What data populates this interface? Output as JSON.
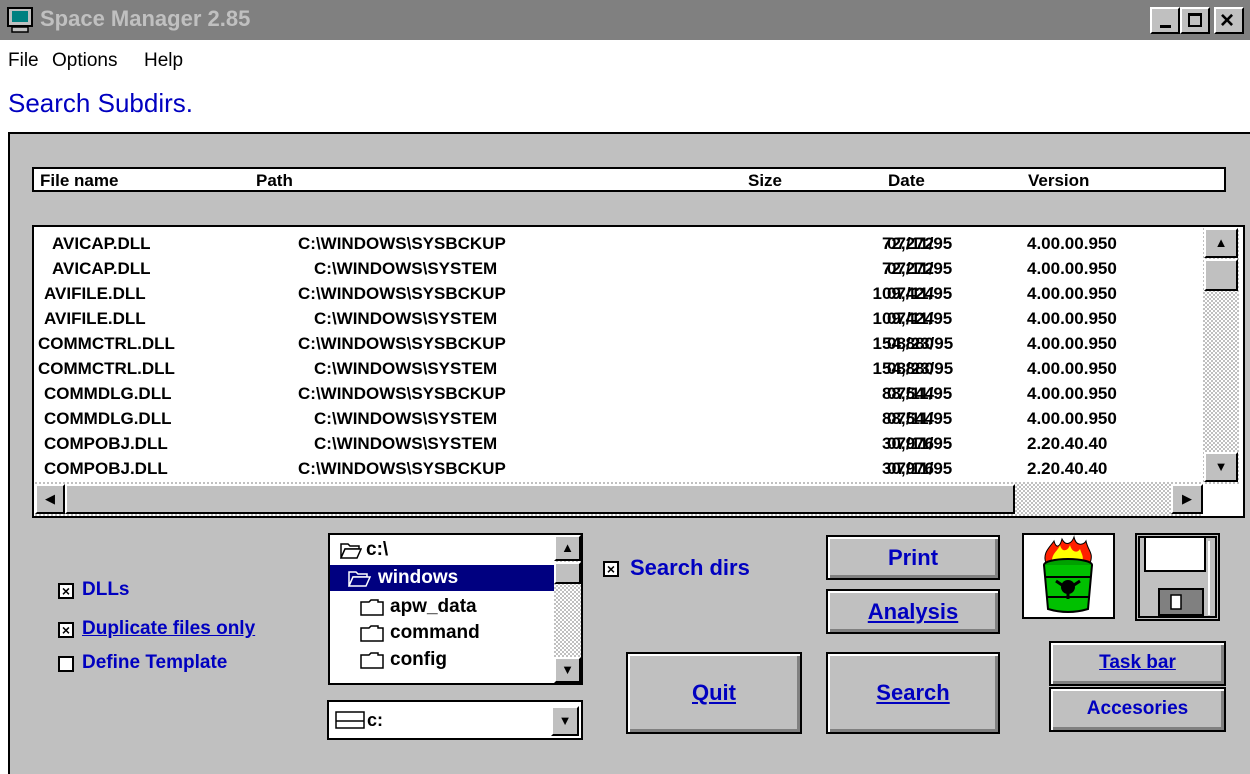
{
  "window": {
    "title": "Space Manager 2.85",
    "minimize_label": "_",
    "maximize_label": "□",
    "close_label": "×"
  },
  "menu": {
    "items": [
      {
        "label": "File"
      },
      {
        "label": "Options"
      },
      {
        "label": "Help"
      }
    ]
  },
  "status_text": "Search Subdirs.",
  "table": {
    "columns": [
      "File name",
      "Path",
      "Size",
      "Date",
      "Version"
    ],
    "rows": [
      {
        "name": "AVICAP.DLL",
        "path": "C:\\WINDOWS\\SYSBCKUP",
        "size": "72,272",
        "date": "07/11/95",
        "version": "4.00.00.950"
      },
      {
        "name": "AVICAP.DLL",
        "path": "C:\\WINDOWS\\SYSTEM",
        "size": "72,272",
        "date": "07/11/95",
        "version": "4.00.00.950"
      },
      {
        "name": "AVIFILE.DLL",
        "path": "C:\\WINDOWS\\SYSBCKUP",
        "size": "109,424",
        "date": "07/11/95",
        "version": "4.00.00.950"
      },
      {
        "name": "AVIFILE.DLL",
        "path": "C:\\WINDOWS\\SYSTEM",
        "size": "109,424",
        "date": "07/11/95",
        "version": "4.00.00.950"
      },
      {
        "name": "COMMCTRL.DLL",
        "path": "C:\\WINDOWS\\SYSBCKUP",
        "size": "154,880",
        "date": "08/23/95",
        "version": "4.00.00.950"
      },
      {
        "name": "COMMCTRL.DLL",
        "path": "C:\\WINDOWS\\SYSTEM",
        "size": "154,880",
        "date": "08/23/95",
        "version": "4.00.00.950"
      },
      {
        "name": "COMMDLG.DLL",
        "path": "C:\\WINDOWS\\SYSBCKUP",
        "size": "88,544",
        "date": "07/11/95",
        "version": "4.00.00.950"
      },
      {
        "name": "COMMDLG.DLL",
        "path": "C:\\WINDOWS\\SYSTEM",
        "size": "88,544",
        "date": "07/11/95",
        "version": "4.00.00.950"
      },
      {
        "name": "COMPOBJ.DLL",
        "path": "C:\\WINDOWS\\SYSTEM",
        "size": "30,976",
        "date": "07/11/95",
        "version": "2.20.40.40"
      },
      {
        "name": "COMPOBJ.DLL",
        "path": "C:\\WINDOWS\\SYSBCKUP",
        "size": "30,976",
        "date": "07/11/95",
        "version": "2.20.40.40"
      }
    ]
  },
  "options": {
    "dlls": {
      "label": "DLLs",
      "checked": true
    },
    "duplicates": {
      "label": "Duplicate files only",
      "checked": true
    },
    "template": {
      "label": "Define Template",
      "checked": false
    },
    "search_dirs": {
      "label": "Search dirs",
      "checked": true
    }
  },
  "directories": {
    "items": [
      {
        "label": "c:\\",
        "selected": false
      },
      {
        "label": "windows",
        "selected": true
      },
      {
        "label": "apw_data",
        "selected": false
      },
      {
        "label": "command",
        "selected": false
      },
      {
        "label": "config",
        "selected": false
      }
    ]
  },
  "drive": {
    "value": "c:"
  },
  "buttons": {
    "print": "Print",
    "analysis": "Analysis",
    "quit": "Quit",
    "search": "Search",
    "taskbar": "Task bar",
    "accessories": "Accesories"
  },
  "colors": {
    "titlebar": "#808080",
    "accent_text": "#0000c0",
    "panel": "#c0c0c0",
    "selection": "#000080"
  },
  "icons": {
    "app": "monitor-icon",
    "trash": "burning-barrel-icon",
    "disk": "floppy-disk-icon"
  }
}
